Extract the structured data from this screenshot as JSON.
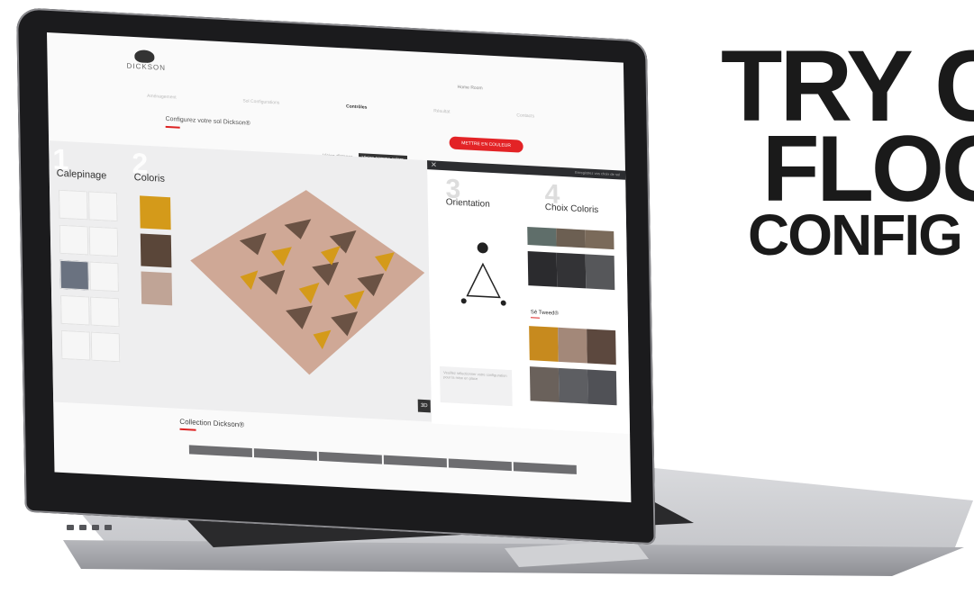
{
  "promo": {
    "line1": "TRY C",
    "line2": "FLOO",
    "line3": "CONFIG"
  },
  "app": {
    "brand": "DICKSON",
    "top_link": "Home Room",
    "steps_nav": [
      {
        "label": "Aménagement",
        "active": false
      },
      {
        "label": "Sol Configurations",
        "active": false
      },
      {
        "label": "Contrôles",
        "active": true
      },
      {
        "label": "Résultat",
        "active": false
      },
      {
        "label": "Contacts",
        "active": false
      }
    ],
    "config_title": "Configurez votre sol Dickson®",
    "cta_label": "METTRE EN COULEUR",
    "view_toggle": {
      "option1": "Vision distance",
      "option2": "Vision gamme colors"
    },
    "step1": {
      "number": "1",
      "label": "Calepinage"
    },
    "step2": {
      "number": "2",
      "label": "Coloris"
    },
    "step3": {
      "number": "3",
      "label": "Orientation"
    },
    "step4": {
      "number": "4",
      "label": "Choix Coloris"
    },
    "panel_hint": "Enregistrez vos choix de sol",
    "swatch_colors": [
      "#d49a1a",
      "#5a4639",
      "#c0a496"
    ],
    "top_swatches": [
      "#5f6e6a",
      "#6c5f52",
      "#7a6a5a",
      "#2b2b2e",
      "#333336",
      "#56575a"
    ],
    "sub_label": "Sé Tweed®",
    "bottom_swatches": [
      "#c78a1e",
      "#a38879",
      "#5c483e",
      "#6a615b",
      "#5d5e62",
      "#505156"
    ],
    "info_text": "Veuillez sélectionner votre configuration pour la mise en place",
    "collection_title": "Collection Dickson®",
    "view_3d": "3D"
  }
}
